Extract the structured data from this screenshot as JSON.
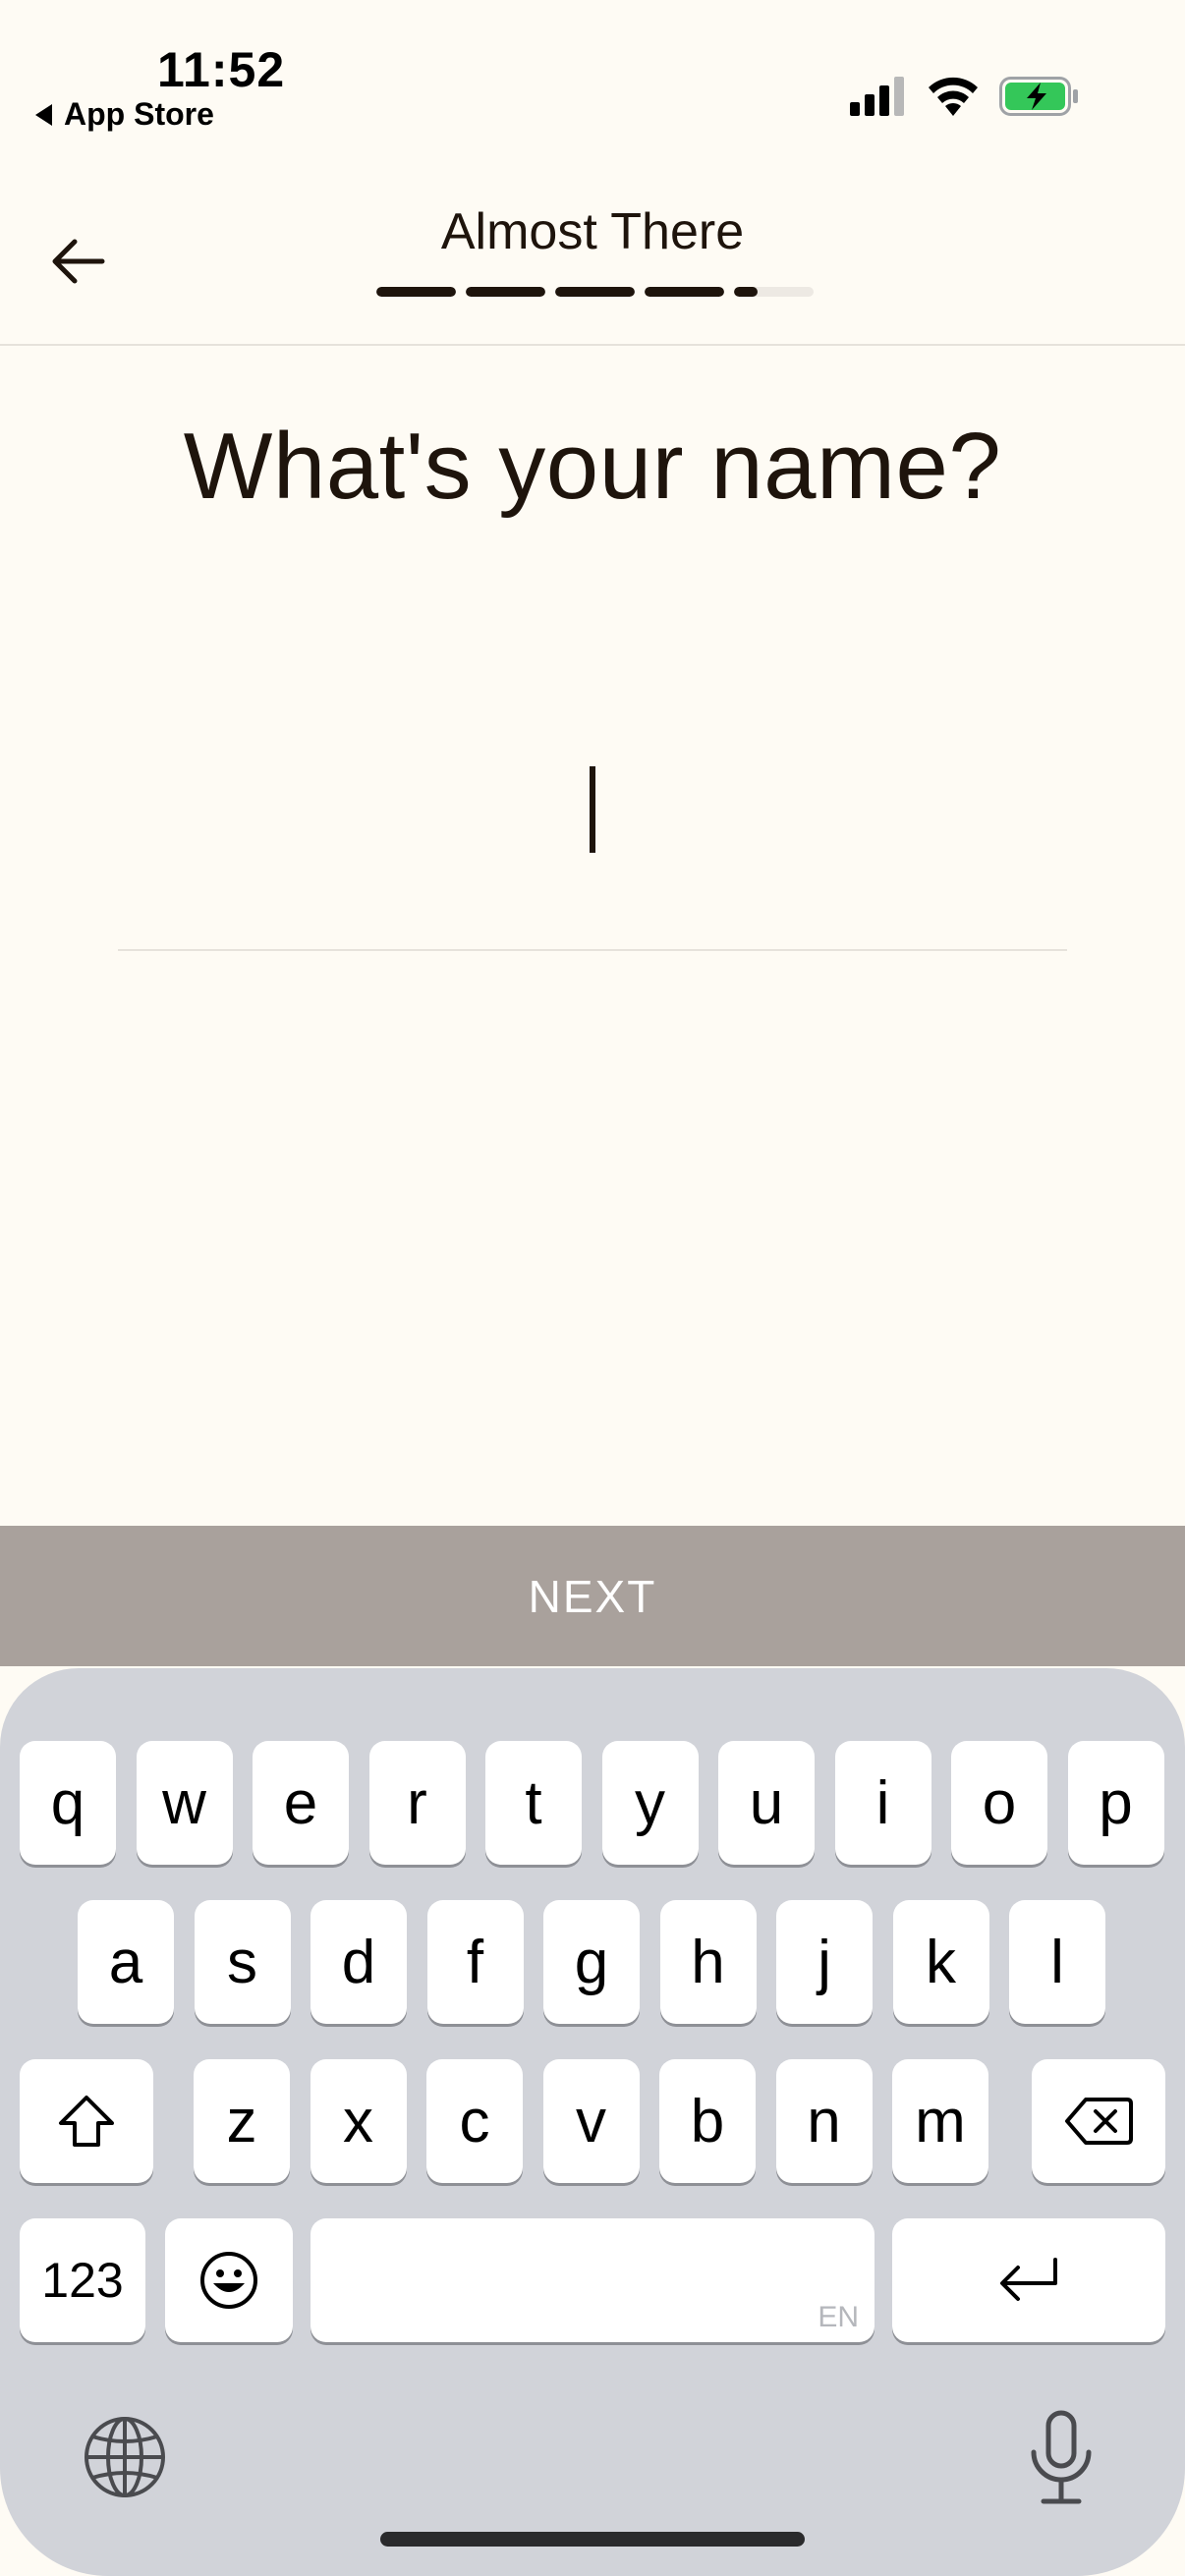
{
  "status_bar": {
    "time": "11:52",
    "back_app_label": "App Store",
    "battery_color": "#34C759"
  },
  "header": {
    "title": "Almost There",
    "progress_segments": [
      1,
      1,
      1,
      1,
      0.3
    ]
  },
  "main": {
    "question": "What's your name?",
    "name_value": "",
    "next_label": "NEXT"
  },
  "keyboard": {
    "row1": [
      "q",
      "w",
      "e",
      "r",
      "t",
      "y",
      "u",
      "i",
      "o",
      "p"
    ],
    "row2": [
      "a",
      "s",
      "d",
      "f",
      "g",
      "h",
      "j",
      "k",
      "l"
    ],
    "row3": [
      "z",
      "x",
      "c",
      "v",
      "b",
      "n",
      "m"
    ],
    "numbers_label": "123",
    "space_language": "EN",
    "shift_icon": "shift-icon",
    "delete_icon": "delete-icon",
    "emoji_icon": "emoji-icon",
    "return_icon": "return-icon",
    "globe_icon": "globe-icon",
    "mic_icon": "mic-icon"
  },
  "colors": {
    "background": "#FEFBF4",
    "text": "#1E140C",
    "next_button": "#A9A19C",
    "keyboard": "#D1D3D9"
  }
}
